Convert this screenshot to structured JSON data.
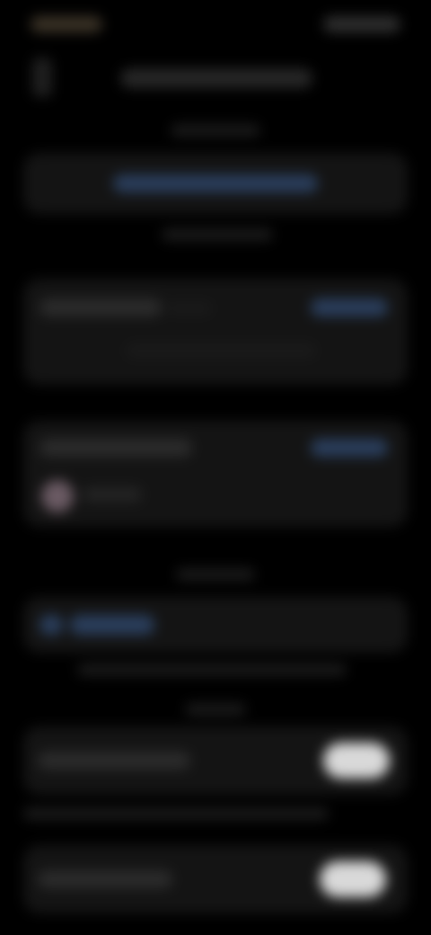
{
  "screen": {
    "blurred": true,
    "theme": "dark",
    "note_visible_text": ""
  },
  "colors": {
    "background": "#000000",
    "card": "#141414",
    "accent_link": "#2a3e5c",
    "toggle_on": "#d9d9d9",
    "avatar": "#6a5a63"
  },
  "toggles": [
    {
      "state": "on"
    },
    {
      "state": "on"
    }
  ]
}
